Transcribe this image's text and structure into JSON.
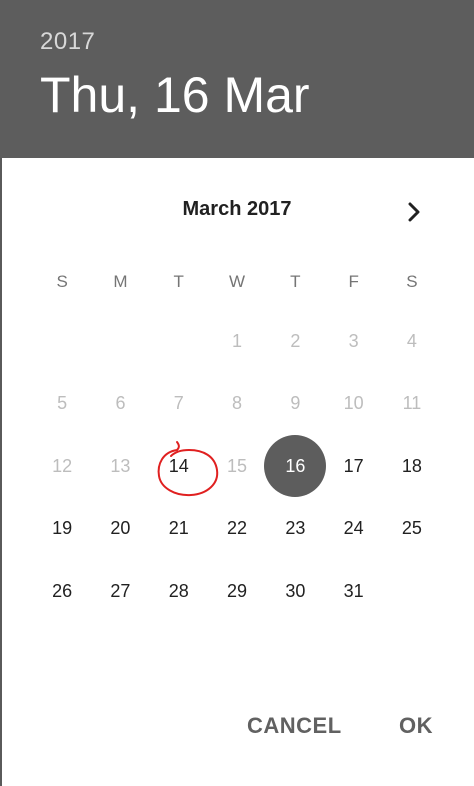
{
  "header": {
    "year": "2017",
    "date": "Thu, 16 Mar"
  },
  "calendar": {
    "month_title": "March 2017",
    "next_icon": "chevron-right-icon",
    "weekdays": [
      "S",
      "M",
      "T",
      "W",
      "T",
      "F",
      "S"
    ],
    "days": [
      {
        "label": "",
        "state": "empty"
      },
      {
        "label": "",
        "state": "empty"
      },
      {
        "label": "",
        "state": "empty"
      },
      {
        "label": "1",
        "state": "disabled"
      },
      {
        "label": "2",
        "state": "disabled"
      },
      {
        "label": "3",
        "state": "disabled"
      },
      {
        "label": "4",
        "state": "disabled"
      },
      {
        "label": "5",
        "state": "disabled"
      },
      {
        "label": "6",
        "state": "disabled"
      },
      {
        "label": "7",
        "state": "disabled"
      },
      {
        "label": "8",
        "state": "disabled"
      },
      {
        "label": "9",
        "state": "disabled"
      },
      {
        "label": "10",
        "state": "disabled"
      },
      {
        "label": "11",
        "state": "disabled"
      },
      {
        "label": "12",
        "state": "disabled"
      },
      {
        "label": "13",
        "state": "disabled"
      },
      {
        "label": "14",
        "state": "enabled"
      },
      {
        "label": "15",
        "state": "disabled"
      },
      {
        "label": "16",
        "state": "selected"
      },
      {
        "label": "17",
        "state": "enabled"
      },
      {
        "label": "18",
        "state": "enabled"
      },
      {
        "label": "19",
        "state": "enabled"
      },
      {
        "label": "20",
        "state": "enabled"
      },
      {
        "label": "21",
        "state": "enabled"
      },
      {
        "label": "22",
        "state": "enabled"
      },
      {
        "label": "23",
        "state": "enabled"
      },
      {
        "label": "24",
        "state": "enabled"
      },
      {
        "label": "25",
        "state": "enabled"
      },
      {
        "label": "26",
        "state": "enabled"
      },
      {
        "label": "27",
        "state": "enabled"
      },
      {
        "label": "28",
        "state": "enabled"
      },
      {
        "label": "29",
        "state": "enabled"
      },
      {
        "label": "30",
        "state": "enabled"
      },
      {
        "label": "31",
        "state": "enabled"
      }
    ]
  },
  "actions": {
    "cancel": "CANCEL",
    "ok": "OK"
  },
  "colors": {
    "header_bg": "#5d5d5d",
    "selected_circle": "#5d5d5d",
    "annotation": "#e02020"
  }
}
